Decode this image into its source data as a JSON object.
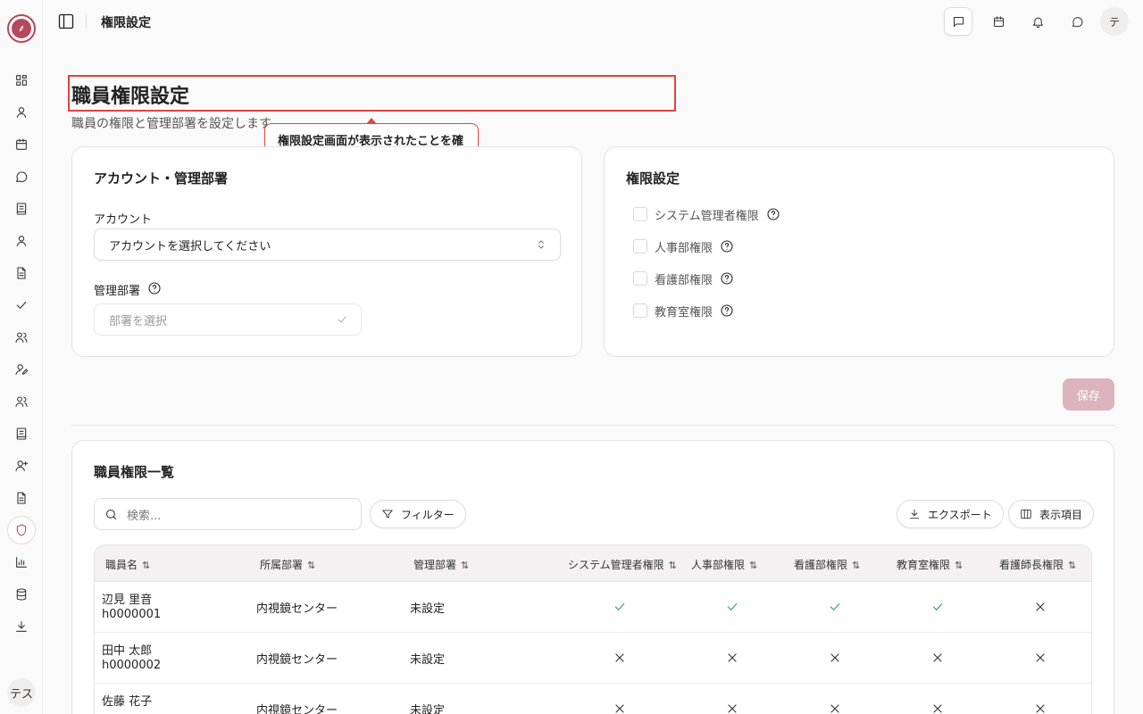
{
  "header": {
    "title": "権限設定"
  },
  "sidebar": {
    "user_initials": "テス",
    "items": [
      {
        "icon": "dashboard-icon"
      },
      {
        "icon": "user-icon"
      },
      {
        "icon": "calendar-icon"
      },
      {
        "icon": "chat-icon"
      },
      {
        "icon": "book-icon"
      },
      {
        "icon": "user-icon"
      },
      {
        "icon": "document-icon"
      },
      {
        "icon": "check-icon"
      },
      {
        "icon": "users-icon"
      },
      {
        "icon": "user-edit-icon"
      },
      {
        "icon": "users-icon"
      },
      {
        "icon": "book-icon"
      },
      {
        "icon": "user-plus-icon"
      },
      {
        "icon": "document-icon"
      },
      {
        "icon": "shield-icon"
      },
      {
        "icon": "bar-chart-icon"
      },
      {
        "icon": "database-icon"
      },
      {
        "icon": "download-icon"
      }
    ]
  },
  "header_actions": {
    "avatar_initial": "テ"
  },
  "page": {
    "title": "職員権限設定",
    "subtitle": "職員の権限と管理部署を設定します",
    "tooltip": "権限設定画面が表示されたことを確認"
  },
  "account_card": {
    "title": "アカウント・管理部署",
    "account_label": "アカウント",
    "account_placeholder": "アカウントを選択してください",
    "department_label": "管理部署",
    "department_placeholder": "部署を選択"
  },
  "permission_card": {
    "title": "権限設定",
    "permissions": [
      "システム管理者権限",
      "人事部権限",
      "看護部権限",
      "教育室権限"
    ]
  },
  "save_label": "保存",
  "list": {
    "title": "職員権限一覧",
    "search_placeholder": "検索...",
    "filter_label": "フィルター",
    "export_label": "エクスポート",
    "columns_label": "表示項目",
    "columns": [
      "職員名",
      "所属部署",
      "管理部署",
      "システム管理者権限",
      "人事部権限",
      "看護部権限",
      "教育室権限",
      "看護師長権限"
    ],
    "rows": [
      {
        "name": "辺見 里音",
        "id": "h0000001",
        "department": "内視鏡センター",
        "managed": "未設定",
        "perms": [
          true,
          true,
          true,
          true,
          false
        ]
      },
      {
        "name": "田中 太郎",
        "id": "h0000002",
        "department": "内視鏡センター",
        "managed": "未設定",
        "perms": [
          false,
          false,
          false,
          false,
          false
        ]
      },
      {
        "name": "佐藤 花子",
        "id": "",
        "department": "内視鏡センター",
        "managed": "未設定",
        "perms": [
          false,
          false,
          false,
          false,
          false
        ]
      }
    ]
  },
  "colors": {
    "accent": "#b5485e",
    "highlight": "#e0443e",
    "check": "#22a55a"
  }
}
